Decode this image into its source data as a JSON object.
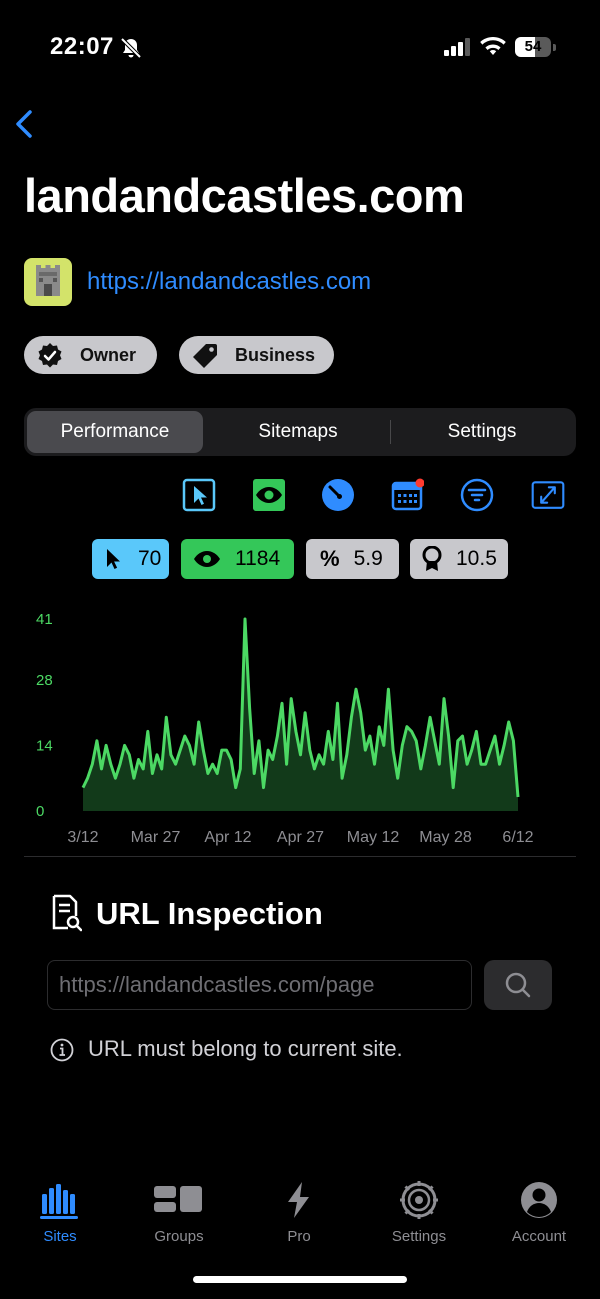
{
  "status_bar": {
    "time": "22:07",
    "battery": "54"
  },
  "header": {
    "title": "landandcastles.com",
    "site_url": "https://landandcastles.com"
  },
  "badges": [
    {
      "label": "Owner"
    },
    {
      "label": "Business"
    }
  ],
  "segments": [
    {
      "label": "Performance",
      "active": true
    },
    {
      "label": "Sitemaps"
    },
    {
      "label": "Settings"
    }
  ],
  "toolbar": {
    "icons": [
      "cursor-icon",
      "eye-icon",
      "gauge-icon",
      "calendar-icon",
      "filter-icon",
      "expand-icon"
    ]
  },
  "stats": {
    "clicks": "70",
    "impressions": "1184",
    "ctr": "5.9",
    "position": "10.5"
  },
  "colors": {
    "accent": "#2f8cff",
    "line": "#4cd964",
    "clicks_bg": "#5ac8fa",
    "impressions_bg": "#34c759",
    "chip_bg": "#c8c8cc"
  },
  "chart_data": {
    "type": "area",
    "y_ticks": [
      "41",
      "28",
      "14",
      "0"
    ],
    "x_ticks": [
      "3/12",
      "Mar 27",
      "Apr 12",
      "Apr 27",
      "May 12",
      "May 28",
      "6/12"
    ],
    "ylim": [
      0,
      41
    ],
    "series": [
      {
        "values": [
          5,
          7,
          10,
          15,
          9,
          14,
          10,
          7,
          10,
          14,
          12,
          7,
          11,
          9,
          17,
          8,
          12,
          9,
          20,
          12,
          10,
          13,
          16,
          14,
          10,
          19,
          13,
          8,
          10,
          8,
          13,
          13,
          11,
          5,
          9,
          41,
          22,
          8,
          15,
          5,
          13,
          11,
          16,
          23,
          10,
          24,
          17,
          12,
          21,
          13,
          9,
          12,
          10,
          17,
          11,
          23,
          7,
          12,
          20,
          26,
          21,
          13,
          16,
          10,
          18,
          14,
          26,
          13,
          7,
          14,
          18,
          17,
          15,
          9,
          14,
          20,
          15,
          10,
          24,
          16,
          5,
          15,
          16,
          10,
          13,
          17,
          10,
          10,
          13,
          16,
          10,
          14,
          19,
          15,
          3
        ]
      }
    ]
  },
  "url_inspection": {
    "title": "URL Inspection",
    "placeholder": "https://landandcastles.com/page",
    "note": "URL must belong to current site."
  },
  "tabbar": [
    {
      "label": "Sites",
      "icon": "bar-chart-icon",
      "active": true
    },
    {
      "label": "Groups",
      "icon": "groups-icon"
    },
    {
      "label": "Pro",
      "icon": "bolt-icon"
    },
    {
      "label": "Settings",
      "icon": "gear-icon"
    },
    {
      "label": "Account",
      "icon": "person-icon"
    }
  ]
}
